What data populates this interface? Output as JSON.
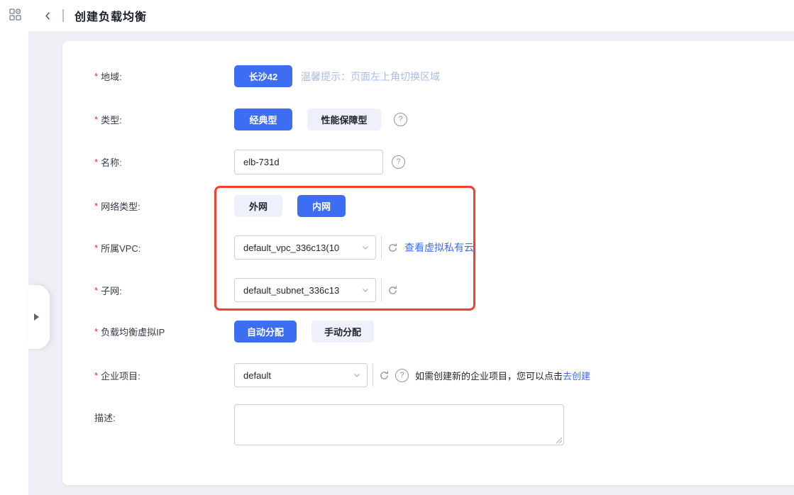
{
  "topbar": {
    "title": "创建负载均衡"
  },
  "icons": {
    "apps": "grid-apps-icon",
    "back": "chevron-left-icon",
    "dropdown": "chevron-down-icon",
    "refresh": "refresh-icon",
    "help_glyph": "?",
    "collapse": "triangle-right-icon",
    "resize": "textarea-resize-grip"
  },
  "colors": {
    "accent_blue": "#3d6df2",
    "highlight_red": "#f6402c",
    "link_blue": "#3d6df5",
    "hint_blue": "#a9bce4",
    "content_bg": "#edeff4"
  },
  "form": {
    "required_marker": "*",
    "region": {
      "label": "地域:",
      "selected": "长沙42",
      "hint": "温馨提示：页面左上角切换区域"
    },
    "type": {
      "label": "类型:",
      "options": [
        "经典型",
        "性能保障型"
      ],
      "selected": "经典型"
    },
    "name": {
      "label": "名称:",
      "value": "elb-731d"
    },
    "network_type": {
      "label": "网络类型:",
      "options": [
        "外网",
        "内网"
      ],
      "selected": "内网"
    },
    "vpc": {
      "label": "所属VPC:",
      "value": "default_vpc_336c13(10",
      "link": "查看虚拟私有云"
    },
    "subnet": {
      "label": "子网:",
      "value": "default_subnet_336c13"
    },
    "vip": {
      "label": "负载均衡虚拟IP",
      "options": [
        "自动分配",
        "手动分配"
      ],
      "selected": "自动分配"
    },
    "enterprise_project": {
      "label": "企业项目:",
      "value": "default",
      "note": "如需创建新的企业项目，您可以点击",
      "note_link": "去创建"
    },
    "description": {
      "label": "描述:",
      "value": ""
    }
  }
}
